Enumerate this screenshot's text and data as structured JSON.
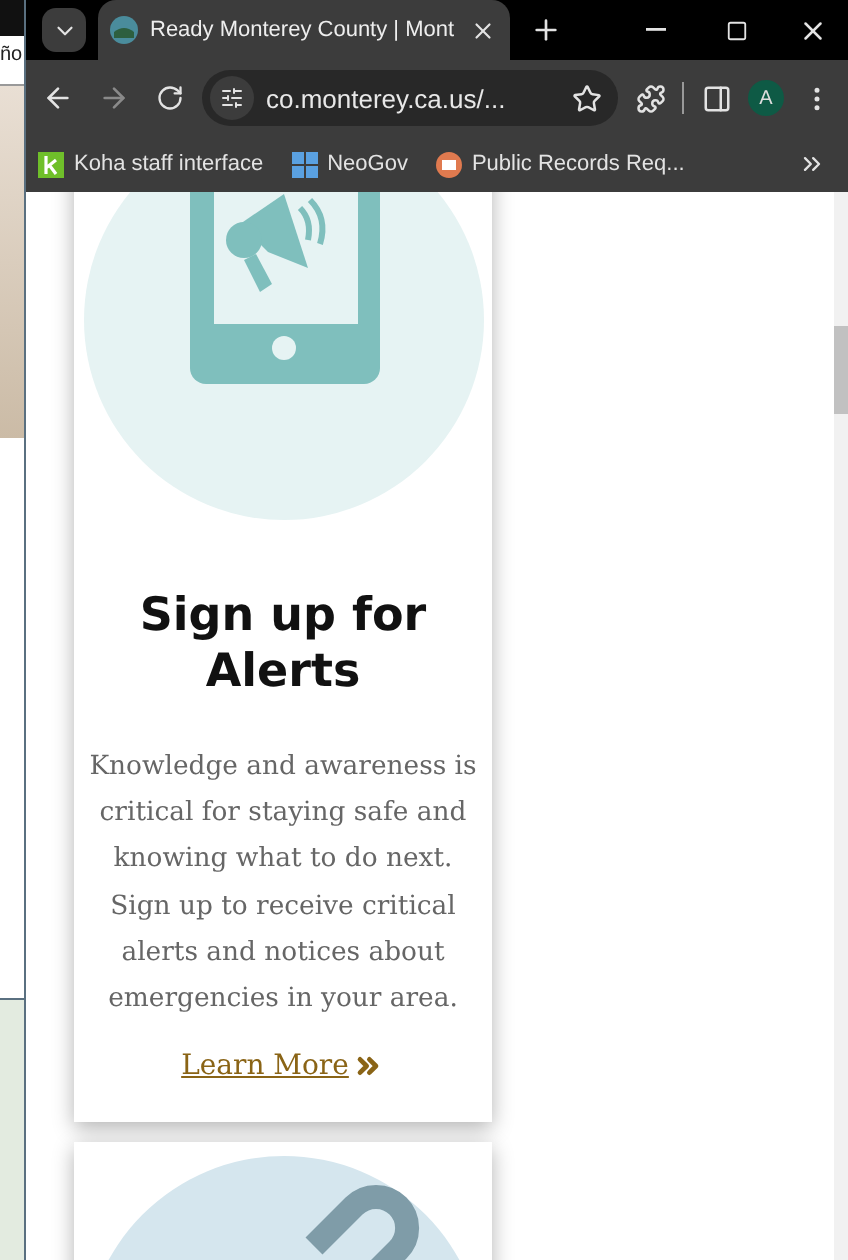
{
  "background_window": {
    "text": "ño"
  },
  "tab_strip": {
    "tabs": [
      {
        "title": "Ready Monterey County | Mont"
      }
    ]
  },
  "toolbar": {
    "url": "co.monterey.ca.us/...",
    "profile_initial": "A"
  },
  "bookmarks": [
    {
      "label": "Koha staff interface",
      "kind": "koha"
    },
    {
      "label": "NeoGov",
      "kind": "grid"
    },
    {
      "label": "Public Records Req...",
      "kind": "records"
    }
  ],
  "cards": [
    {
      "title": "Sign up for Alerts",
      "body": "Knowledge and awareness is critical for staying safe and knowing what to do next. Sign up to receive critical alerts and notices about emergencies in your area.",
      "link": "Learn More"
    }
  ]
}
